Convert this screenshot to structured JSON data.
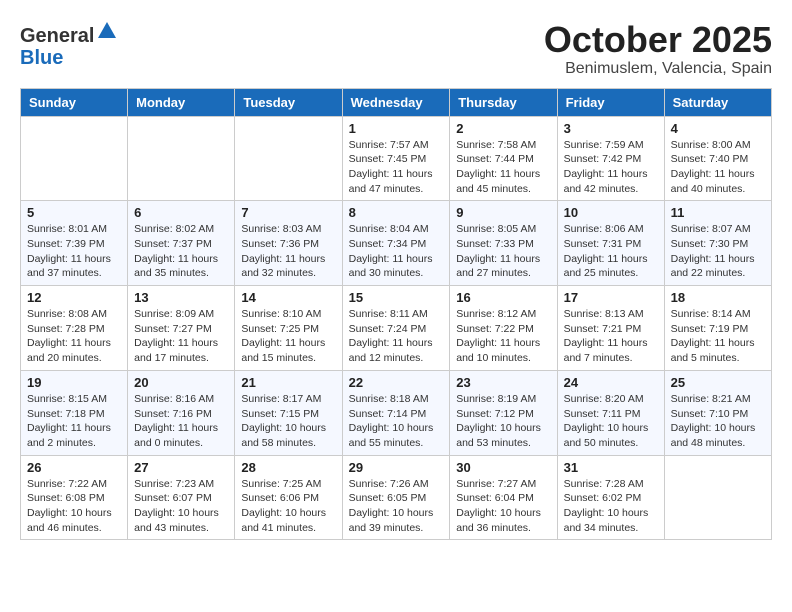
{
  "header": {
    "logo_general": "General",
    "logo_blue": "Blue",
    "month_title": "October 2025",
    "location": "Benimuslem, Valencia, Spain"
  },
  "weekdays": [
    "Sunday",
    "Monday",
    "Tuesday",
    "Wednesday",
    "Thursday",
    "Friday",
    "Saturday"
  ],
  "weeks": [
    [
      {
        "day": "",
        "detail": ""
      },
      {
        "day": "",
        "detail": ""
      },
      {
        "day": "",
        "detail": ""
      },
      {
        "day": "1",
        "detail": "Sunrise: 7:57 AM\nSunset: 7:45 PM\nDaylight: 11 hours and 47 minutes."
      },
      {
        "day": "2",
        "detail": "Sunrise: 7:58 AM\nSunset: 7:44 PM\nDaylight: 11 hours and 45 minutes."
      },
      {
        "day": "3",
        "detail": "Sunrise: 7:59 AM\nSunset: 7:42 PM\nDaylight: 11 hours and 42 minutes."
      },
      {
        "day": "4",
        "detail": "Sunrise: 8:00 AM\nSunset: 7:40 PM\nDaylight: 11 hours and 40 minutes."
      }
    ],
    [
      {
        "day": "5",
        "detail": "Sunrise: 8:01 AM\nSunset: 7:39 PM\nDaylight: 11 hours and 37 minutes."
      },
      {
        "day": "6",
        "detail": "Sunrise: 8:02 AM\nSunset: 7:37 PM\nDaylight: 11 hours and 35 minutes."
      },
      {
        "day": "7",
        "detail": "Sunrise: 8:03 AM\nSunset: 7:36 PM\nDaylight: 11 hours and 32 minutes."
      },
      {
        "day": "8",
        "detail": "Sunrise: 8:04 AM\nSunset: 7:34 PM\nDaylight: 11 hours and 30 minutes."
      },
      {
        "day": "9",
        "detail": "Sunrise: 8:05 AM\nSunset: 7:33 PM\nDaylight: 11 hours and 27 minutes."
      },
      {
        "day": "10",
        "detail": "Sunrise: 8:06 AM\nSunset: 7:31 PM\nDaylight: 11 hours and 25 minutes."
      },
      {
        "day": "11",
        "detail": "Sunrise: 8:07 AM\nSunset: 7:30 PM\nDaylight: 11 hours and 22 minutes."
      }
    ],
    [
      {
        "day": "12",
        "detail": "Sunrise: 8:08 AM\nSunset: 7:28 PM\nDaylight: 11 hours and 20 minutes."
      },
      {
        "day": "13",
        "detail": "Sunrise: 8:09 AM\nSunset: 7:27 PM\nDaylight: 11 hours and 17 minutes."
      },
      {
        "day": "14",
        "detail": "Sunrise: 8:10 AM\nSunset: 7:25 PM\nDaylight: 11 hours and 15 minutes."
      },
      {
        "day": "15",
        "detail": "Sunrise: 8:11 AM\nSunset: 7:24 PM\nDaylight: 11 hours and 12 minutes."
      },
      {
        "day": "16",
        "detail": "Sunrise: 8:12 AM\nSunset: 7:22 PM\nDaylight: 11 hours and 10 minutes."
      },
      {
        "day": "17",
        "detail": "Sunrise: 8:13 AM\nSunset: 7:21 PM\nDaylight: 11 hours and 7 minutes."
      },
      {
        "day": "18",
        "detail": "Sunrise: 8:14 AM\nSunset: 7:19 PM\nDaylight: 11 hours and 5 minutes."
      }
    ],
    [
      {
        "day": "19",
        "detail": "Sunrise: 8:15 AM\nSunset: 7:18 PM\nDaylight: 11 hours and 2 minutes."
      },
      {
        "day": "20",
        "detail": "Sunrise: 8:16 AM\nSunset: 7:16 PM\nDaylight: 11 hours and 0 minutes."
      },
      {
        "day": "21",
        "detail": "Sunrise: 8:17 AM\nSunset: 7:15 PM\nDaylight: 10 hours and 58 minutes."
      },
      {
        "day": "22",
        "detail": "Sunrise: 8:18 AM\nSunset: 7:14 PM\nDaylight: 10 hours and 55 minutes."
      },
      {
        "day": "23",
        "detail": "Sunrise: 8:19 AM\nSunset: 7:12 PM\nDaylight: 10 hours and 53 minutes."
      },
      {
        "day": "24",
        "detail": "Sunrise: 8:20 AM\nSunset: 7:11 PM\nDaylight: 10 hours and 50 minutes."
      },
      {
        "day": "25",
        "detail": "Sunrise: 8:21 AM\nSunset: 7:10 PM\nDaylight: 10 hours and 48 minutes."
      }
    ],
    [
      {
        "day": "26",
        "detail": "Sunrise: 7:22 AM\nSunset: 6:08 PM\nDaylight: 10 hours and 46 minutes."
      },
      {
        "day": "27",
        "detail": "Sunrise: 7:23 AM\nSunset: 6:07 PM\nDaylight: 10 hours and 43 minutes."
      },
      {
        "day": "28",
        "detail": "Sunrise: 7:25 AM\nSunset: 6:06 PM\nDaylight: 10 hours and 41 minutes."
      },
      {
        "day": "29",
        "detail": "Sunrise: 7:26 AM\nSunset: 6:05 PM\nDaylight: 10 hours and 39 minutes."
      },
      {
        "day": "30",
        "detail": "Sunrise: 7:27 AM\nSunset: 6:04 PM\nDaylight: 10 hours and 36 minutes."
      },
      {
        "day": "31",
        "detail": "Sunrise: 7:28 AM\nSunset: 6:02 PM\nDaylight: 10 hours and 34 minutes."
      },
      {
        "day": "",
        "detail": ""
      }
    ]
  ]
}
